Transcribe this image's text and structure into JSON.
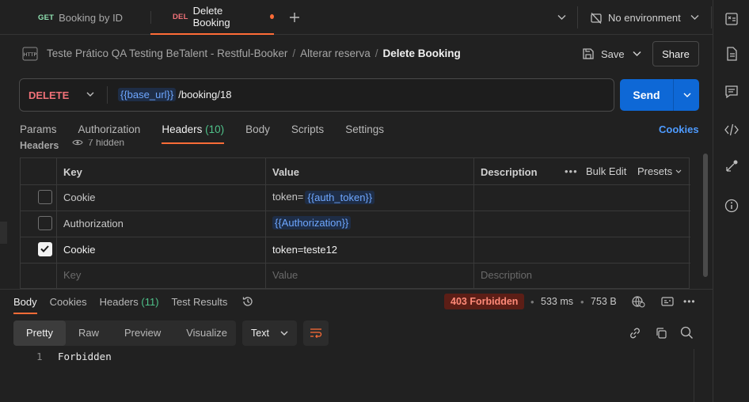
{
  "tabs": [
    {
      "method": "GET",
      "label": "Booking by ID",
      "method_color": "#6bdd9a"
    },
    {
      "method": "DEL",
      "label": "Delete Booking",
      "method_color": "#f07178"
    }
  ],
  "environment": "No environment",
  "breadcrumb": {
    "collection": "Teste Prático QA Testing BeTalent - Restful-Booker",
    "folder": "Alterar reserva",
    "request": "Delete Booking",
    "sep": "/"
  },
  "actions": {
    "save": "Save",
    "share": "Share"
  },
  "request": {
    "method": "DELETE",
    "url_var": "{{base_url}}",
    "url_path": "/booking/18",
    "send": "Send"
  },
  "request_tabs": [
    {
      "label": "Params"
    },
    {
      "label": "Authorization"
    },
    {
      "label": "Headers",
      "count": "(10)"
    },
    {
      "label": "Body"
    },
    {
      "label": "Scripts"
    },
    {
      "label": "Settings"
    }
  ],
  "cookies_link": "Cookies",
  "headers_section": {
    "title": "Headers",
    "hidden": "7 hidden"
  },
  "table": {
    "columns": {
      "key": "Key",
      "value": "Value",
      "description": "Description"
    },
    "bulk_edit": "Bulk Edit",
    "presets": "Presets",
    "rows": [
      {
        "checked": false,
        "key": "Cookie",
        "value_prefix": "token=",
        "value_var": "{{auth_token}}"
      },
      {
        "checked": false,
        "key": "Authorization",
        "value_prefix": "",
        "value_var": "{{Authorization}}"
      },
      {
        "checked": true,
        "key": "Cookie",
        "value_prefix": "token=teste12",
        "value_var": ""
      }
    ],
    "placeholder": {
      "key": "Key",
      "value": "Value",
      "description": "Description"
    }
  },
  "response": {
    "tabs": [
      {
        "label": "Body"
      },
      {
        "label": "Cookies"
      },
      {
        "label": "Headers",
        "count": "(11)"
      },
      {
        "label": "Test Results"
      }
    ],
    "status": "403 Forbidden",
    "time": "533 ms",
    "size": "753 B",
    "sep": "•",
    "view_modes": [
      "Pretty",
      "Raw",
      "Preview",
      "Visualize"
    ],
    "format": "Text",
    "lines": [
      {
        "num": "1",
        "text": "Forbidden"
      }
    ]
  },
  "colors": {
    "accent": "#ff6c37",
    "send": "#0e68d6",
    "link": "#4e9bff",
    "success": "#4fc28a",
    "error": "#ff8a78"
  }
}
